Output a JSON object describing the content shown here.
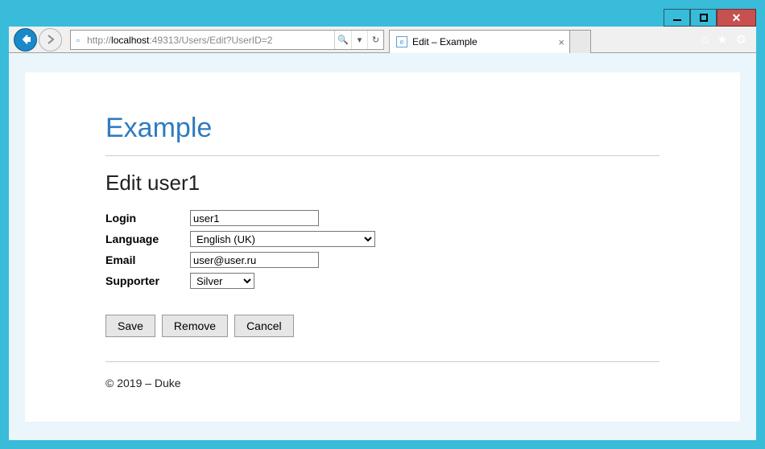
{
  "titlebar": {
    "minimize_icon": "minimize-icon",
    "maximize_icon": "maximize-icon",
    "close_icon": "close-icon"
  },
  "browser": {
    "url_prefix": "http://",
    "url_host": "localhost",
    "url_path": ":49313/Users/Edit?UserID=2",
    "tab_title": "Edit – Example",
    "search_hint": "search",
    "refresh_hint": "refresh"
  },
  "page": {
    "brand": "Example",
    "heading": "Edit user1",
    "fields": {
      "login_label": "Login",
      "login_value": "user1",
      "language_label": "Language",
      "language_value": "English (UK)",
      "email_label": "Email",
      "email_value": "user@user.ru",
      "supporter_label": "Supporter",
      "supporter_value": "Silver"
    },
    "buttons": {
      "save": "Save",
      "remove": "Remove",
      "cancel": "Cancel"
    },
    "footer": "© 2019 – Duke"
  }
}
